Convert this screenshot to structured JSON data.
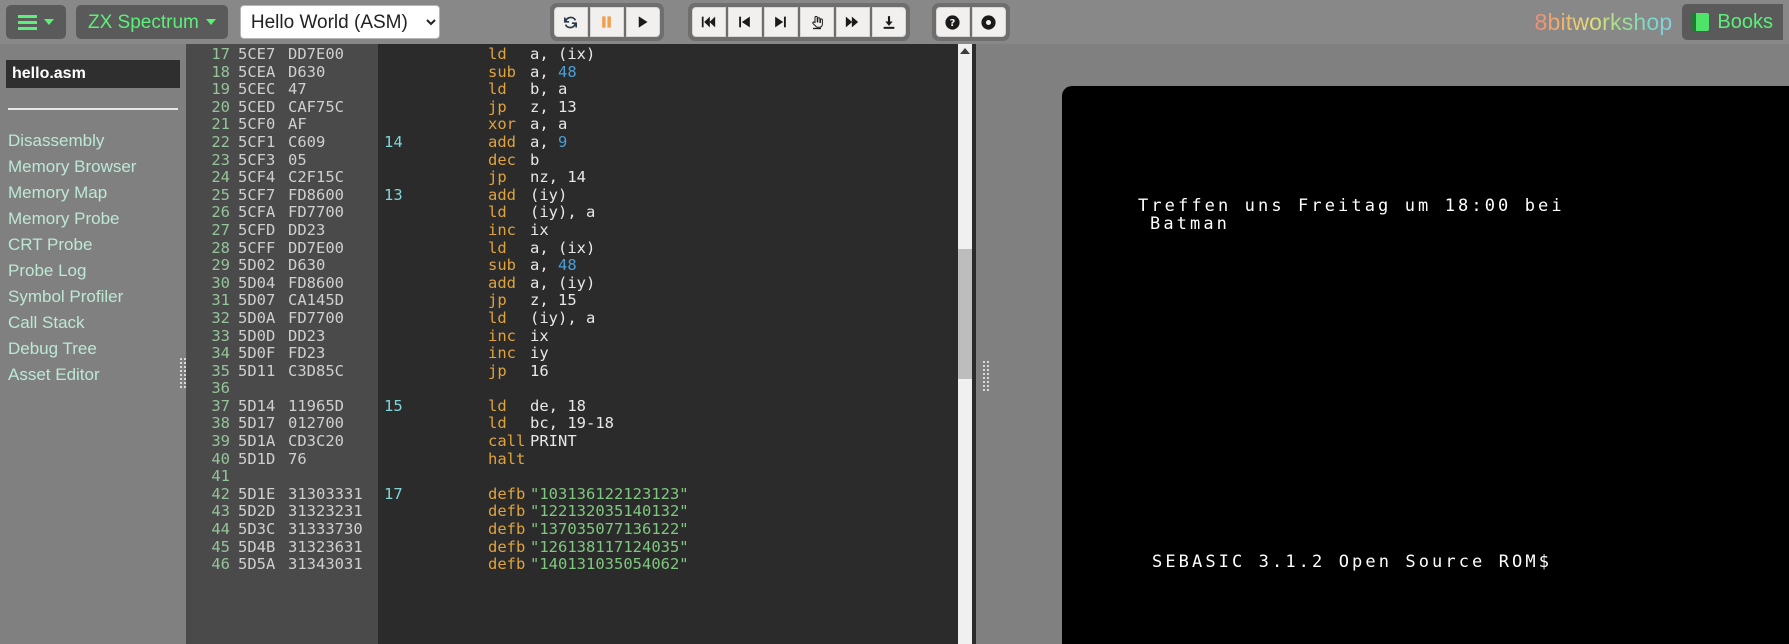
{
  "toolbar": {
    "menu_button": {
      "icon": "hamburger-icon",
      "label": ""
    },
    "platform_button": {
      "label": "ZX Spectrum",
      "icon": "caret-down-icon"
    },
    "file_select": {
      "value": "Hello World (ASM)",
      "options": [
        "Hello World (ASM)"
      ]
    },
    "run_group": [
      {
        "name": "reset-button",
        "icon": "reset-icon",
        "glyph": "↻"
      },
      {
        "name": "pause-button",
        "icon": "pause-icon",
        "glyph": "⏸"
      },
      {
        "name": "play-button",
        "icon": "play-icon",
        "glyph": "▶"
      }
    ],
    "step_group": [
      {
        "name": "step-backwards-button",
        "icon": "skip-backward-icon"
      },
      {
        "name": "step-back-button",
        "icon": "step-back-icon"
      },
      {
        "name": "step-forward-button",
        "icon": "step-forward-icon"
      },
      {
        "name": "single-step-button",
        "icon": "hand-pointer-icon"
      },
      {
        "name": "fast-forward-button",
        "icon": "fast-forward-icon"
      },
      {
        "name": "download-button",
        "icon": "download-icon"
      }
    ],
    "help_group": [
      {
        "name": "help-button",
        "icon": "question-circle-icon"
      },
      {
        "name": "record-button",
        "icon": "record-circle-icon"
      }
    ],
    "brand": "8bitworkshop",
    "books_button": {
      "label": "Books",
      "icon": "book-icon"
    }
  },
  "sidebar": {
    "current_file": "hello.asm",
    "items": [
      {
        "label": "Disassembly"
      },
      {
        "label": "Memory Browser"
      },
      {
        "label": "Memory Map"
      },
      {
        "label": "Memory Probe"
      },
      {
        "label": "CRT Probe"
      },
      {
        "label": "Probe Log"
      },
      {
        "label": "Symbol Profiler"
      },
      {
        "label": "Call Stack"
      },
      {
        "label": "Debug Tree"
      },
      {
        "label": "Asset Editor"
      }
    ]
  },
  "editor": {
    "columns": [
      "line",
      "address",
      "bytes",
      "label",
      "mnemonic",
      "operands"
    ],
    "rows": [
      {
        "line": "17",
        "addr": "5CE7",
        "bytes": "DD7E00",
        "label": "",
        "mnem": "ld",
        "ops": "a, (ix)"
      },
      {
        "line": "18",
        "addr": "5CEA",
        "bytes": "D630",
        "label": "",
        "mnem": "sub",
        "ops": "a, 48",
        "num": "48"
      },
      {
        "line": "19",
        "addr": "5CEC",
        "bytes": "47",
        "label": "",
        "mnem": "ld",
        "ops": "b, a"
      },
      {
        "line": "20",
        "addr": "5CED",
        "bytes": "CAF75C",
        "label": "",
        "mnem": "jp",
        "ops": "z, 13"
      },
      {
        "line": "21",
        "addr": "5CF0",
        "bytes": "AF",
        "label": "",
        "mnem": "xor",
        "ops": "a, a"
      },
      {
        "line": "22",
        "addr": "5CF1",
        "bytes": "C609",
        "label": "14",
        "mnem": "add",
        "ops": "a, 9",
        "num": "9"
      },
      {
        "line": "23",
        "addr": "5CF3",
        "bytes": "05",
        "label": "",
        "mnem": "dec",
        "ops": "b"
      },
      {
        "line": "24",
        "addr": "5CF4",
        "bytes": "C2F15C",
        "label": "",
        "mnem": "jp",
        "ops": "nz, 14"
      },
      {
        "line": "25",
        "addr": "5CF7",
        "bytes": "FD8600",
        "label": "13",
        "mnem": "add",
        "ops": "(iy)"
      },
      {
        "line": "26",
        "addr": "5CFA",
        "bytes": "FD7700",
        "label": "",
        "mnem": "ld",
        "ops": "(iy), a"
      },
      {
        "line": "27",
        "addr": "5CFD",
        "bytes": "DD23",
        "label": "",
        "mnem": "inc",
        "ops": "ix"
      },
      {
        "line": "28",
        "addr": "5CFF",
        "bytes": "DD7E00",
        "label": "",
        "mnem": "ld",
        "ops": "a, (ix)"
      },
      {
        "line": "29",
        "addr": "5D02",
        "bytes": "D630",
        "label": "",
        "mnem": "sub",
        "ops": "a, 48",
        "num": "48"
      },
      {
        "line": "30",
        "addr": "5D04",
        "bytes": "FD8600",
        "label": "",
        "mnem": "add",
        "ops": "a, (iy)"
      },
      {
        "line": "31",
        "addr": "5D07",
        "bytes": "CA145D",
        "label": "",
        "mnem": "jp",
        "ops": "z, 15"
      },
      {
        "line": "32",
        "addr": "5D0A",
        "bytes": "FD7700",
        "label": "",
        "mnem": "ld",
        "ops": "(iy), a"
      },
      {
        "line": "33",
        "addr": "5D0D",
        "bytes": "DD23",
        "label": "",
        "mnem": "inc",
        "ops": "ix"
      },
      {
        "line": "34",
        "addr": "5D0F",
        "bytes": "FD23",
        "label": "",
        "mnem": "inc",
        "ops": "iy"
      },
      {
        "line": "35",
        "addr": "5D11",
        "bytes": "C3D85C",
        "label": "",
        "mnem": "jp",
        "ops": "16"
      },
      {
        "line": "36",
        "addr": "",
        "bytes": "",
        "label": "",
        "mnem": "",
        "ops": ""
      },
      {
        "line": "37",
        "addr": "5D14",
        "bytes": "11965D",
        "label": "15",
        "mnem": "ld",
        "ops": "de, 18"
      },
      {
        "line": "38",
        "addr": "5D17",
        "bytes": "012700",
        "label": "",
        "mnem": "ld",
        "ops": "bc, 19-18"
      },
      {
        "line": "39",
        "addr": "5D1A",
        "bytes": "CD3C20",
        "label": "",
        "mnem": "call",
        "ops": "PRINT"
      },
      {
        "line": "40",
        "addr": "5D1D",
        "bytes": "76",
        "label": "",
        "mnem": "halt",
        "ops": ""
      },
      {
        "line": "41",
        "addr": "",
        "bytes": "",
        "label": "",
        "mnem": "",
        "ops": ""
      },
      {
        "line": "42",
        "addr": "5D1E",
        "bytes": "31303331",
        "label": "17",
        "mnem": "defb",
        "ops": "\"103136122123123\"",
        "string": true
      },
      {
        "line": "43",
        "addr": "5D2D",
        "bytes": "31323231",
        "label": "",
        "mnem": "defb",
        "ops": "\"122132035140132\"",
        "string": true
      },
      {
        "line": "44",
        "addr": "5D3C",
        "bytes": "31333730",
        "label": "",
        "mnem": "defb",
        "ops": "\"137035077136122\"",
        "string": true
      },
      {
        "line": "45",
        "addr": "5D4B",
        "bytes": "31323631",
        "label": "",
        "mnem": "defb",
        "ops": "\"126138117124035\"",
        "string": true
      },
      {
        "line": "46",
        "addr": "5D5A",
        "bytes": "31343031",
        "label": "",
        "mnem": "defb",
        "ops": "\"140131035054062\"",
        "string": true
      }
    ]
  },
  "emulator": {
    "screen_lines": [
      "Treffen uns Freitag um 18:00 bei",
      "Batman",
      "SEBASIC 3.1.2 Open Source ROM$"
    ]
  },
  "colors": {
    "accent_green": "#5cf07a",
    "toolbar_bg": "#888888",
    "sidebar_link": "#bde8d4",
    "editor_bg": "#2b2b2b",
    "gutter_bg": "#4a4a4a",
    "lineno": "#94c49a",
    "mnemonic": "#e0a33c",
    "label": "#7fd6d6",
    "number": "#4a9fd8",
    "string": "#7fc87f",
    "emu_bg": "#000000"
  }
}
